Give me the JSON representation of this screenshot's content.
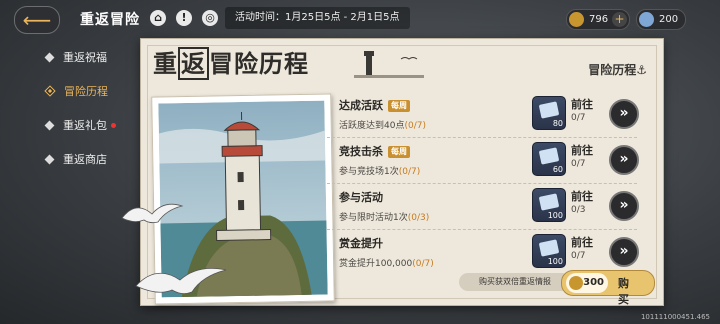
{
  "header": {
    "title": "重返冒险",
    "event_time": "活动时间：1月25日5点 - 2月1日5点"
  },
  "currencies": [
    {
      "icon": "gold-coin-icon",
      "amount": "796",
      "has_plus": true
    },
    {
      "icon": "crystal-icon",
      "amount": "200",
      "has_plus": false
    }
  ],
  "menu": {
    "items": [
      {
        "label": "重返祝福",
        "active": false,
        "alert": false
      },
      {
        "label": "冒险历程",
        "active": true,
        "alert": false
      },
      {
        "label": "重返礼包",
        "active": false,
        "alert": true
      },
      {
        "label": "重返商店",
        "active": false,
        "alert": false
      }
    ]
  },
  "panel": {
    "title_boxed": "返",
    "title_pre": "重",
    "title_post": "冒险历程",
    "section_label": "冒险历程⚓"
  },
  "tasks": [
    {
      "name": "达成活跃",
      "weekly": "每周",
      "desc": "活跃度达到40点",
      "progress": "(0/7)",
      "reward": "80",
      "goto": "前往",
      "goto_progress": "0/7"
    },
    {
      "name": "竞技击杀",
      "weekly": "每周",
      "desc": "参与竞技场1次",
      "progress": "(0/7)",
      "reward": "60",
      "goto": "前往",
      "goto_progress": "0/7"
    },
    {
      "name": "参与活动",
      "weekly": "",
      "desc": "参与限时活动1次",
      "progress": "(0/3)",
      "reward": "100",
      "goto": "前往",
      "goto_progress": "0/3"
    },
    {
      "name": "赏金提升",
      "weekly": "",
      "desc": "赏金提升100,000",
      "progress": "(0/7)",
      "reward": "100",
      "goto": "前往",
      "goto_progress": "0/7"
    }
  ],
  "purchase": {
    "info": "购买获双倍重返情报",
    "price": "300",
    "label": "购 买"
  },
  "footer": {
    "uid": "101111000451.465"
  },
  "colors": {
    "accent": "#e9b45a",
    "paper": "#eee8dc",
    "progress": "#c77b1c"
  }
}
